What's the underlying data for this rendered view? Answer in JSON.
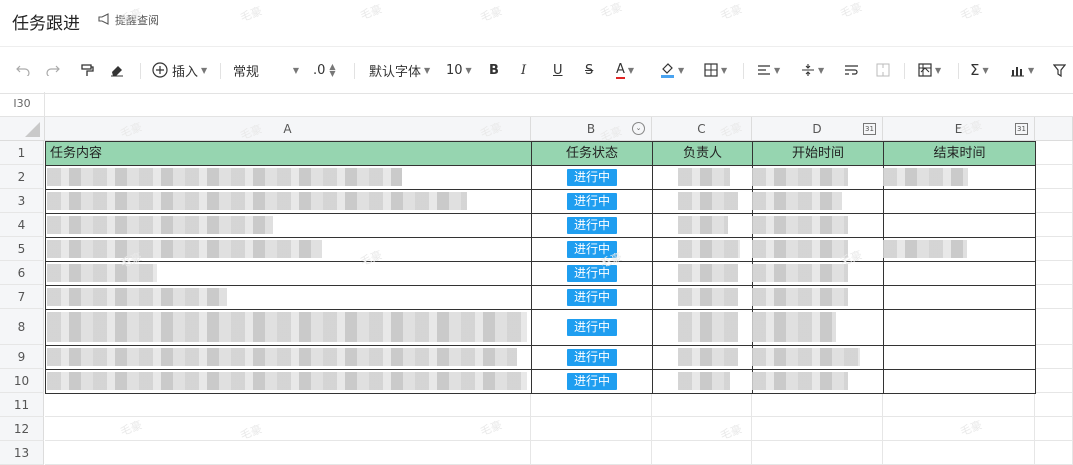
{
  "doc": {
    "title": "任务跟进",
    "remind_label": "提醒查阅"
  },
  "toolbar": {
    "insert_label": "插入",
    "number_format": "常规",
    "decimal_label": ".0",
    "font_family": "默认字体",
    "font_size": "10",
    "bold": "B",
    "italic": "I",
    "underline": "U",
    "strike": "S",
    "font_color": "A",
    "sum_label": "Σ"
  },
  "formula_bar": {
    "cell_ref": "I30"
  },
  "columns": [
    "A",
    "B",
    "C",
    "D",
    "E"
  ],
  "rows": [
    "1",
    "2",
    "3",
    "4",
    "5",
    "6",
    "7",
    "8",
    "9",
    "10",
    "11",
    "12",
    "13"
  ],
  "table": {
    "headers": [
      "任务内容",
      "任务状态",
      "负责人",
      "开始时间",
      "结束时间"
    ],
    "statuses": [
      "进行中",
      "进行中",
      "进行中",
      "进行中",
      "进行中",
      "进行中",
      "进行中",
      "进行中",
      "进行中"
    ]
  },
  "watermark": "毛豪",
  "colors": {
    "header_bg": "#96d5b0",
    "badge_bg": "#1f9ef0"
  }
}
